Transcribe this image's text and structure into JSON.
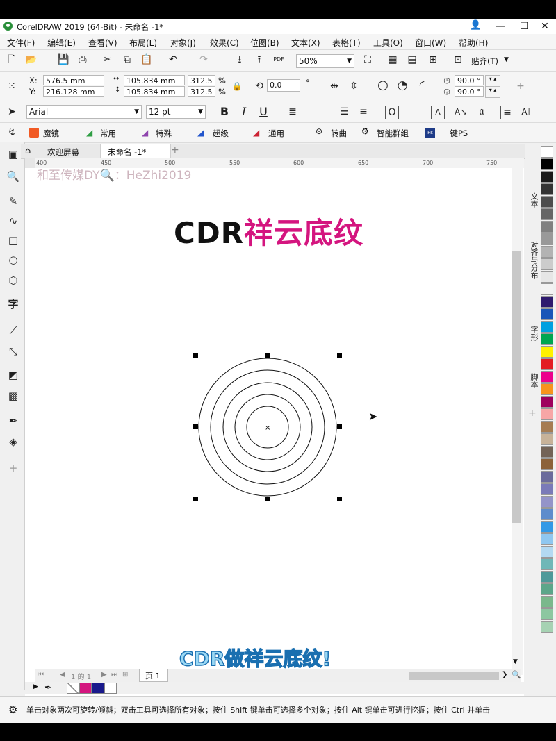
{
  "window": {
    "title": "CorelDRAW 2019 (64-Bit) - 未命名 -1*"
  },
  "menu": [
    "文件(F)",
    "编辑(E)",
    "查看(V)",
    "布局(L)",
    "对象(J)",
    "效果(C)",
    "位图(B)",
    "文本(X)",
    "表格(T)",
    "工具(O)",
    "窗口(W)",
    "帮助(H)"
  ],
  "standard": {
    "zoom": "50%",
    "snap_label": "贴齐(T)"
  },
  "property": {
    "x_label": "X:",
    "x_value": "576.5 mm",
    "y_label": "Y:",
    "y_value": "216.128 mm",
    "w_value": "105.834 mm",
    "h_value": "105.834 mm",
    "sx_value": "312.5",
    "sy_value": "312.5",
    "pct": "%",
    "pct2": "%",
    "rotation": "0.0",
    "deg": "°",
    "arc_start": "90.0 °",
    "arc_end": "90.0 °"
  },
  "text_bar": {
    "font": "Arial",
    "size": "12 pt"
  },
  "plugin_bar": {
    "items": [
      "魔镜",
      "常用",
      "特殊",
      "超级",
      "通用",
      "转曲",
      "智能群组",
      "一键PS"
    ]
  },
  "tabs": {
    "welcome": "欢迎屏幕",
    "doc": "未命名 -1*"
  },
  "ruler": {
    "ticks": [
      "400",
      "450",
      "500",
      "550",
      "600",
      "650",
      "700",
      "750"
    ]
  },
  "canvas": {
    "watermark": "和至传媒DY🔍：HeZhi2019",
    "title_part1": "CDR",
    "title_part2": "祥云底纹",
    "subtitle": "CDR做祥云底纹!"
  },
  "dockers": [
    "文本",
    "对齐与分布",
    "字形",
    "脚本"
  ],
  "pagebar": {
    "page_label": "页 1",
    "counter": "1 的 1"
  },
  "status": {
    "message": "单击对象两次可旋转/倾斜；双击工具可选择所有对象；按住 Shift 键单击可选择多个对象；按住 Alt 键单击可进行挖掘；按住 Ctrl 并单击"
  },
  "palette_colors": [
    "#ffffff",
    "#000000",
    "#1a1a1a",
    "#333333",
    "#4d4d4d",
    "#666666",
    "#808080",
    "#999999",
    "#b3b3b3",
    "#cccccc",
    "#e6e6e6",
    "#f2f2f2",
    "#2e1a6e",
    "#1a56b8",
    "#00a0e0",
    "#00a651",
    "#fff200",
    "#e31e24",
    "#ec008c",
    "#f7941d",
    "#9e005d",
    "#f7a6a6",
    "#a67c52",
    "#c7b299",
    "#736357",
    "#8c6239",
    "#6b6b9c",
    "#7a7ab8",
    "#9494c9",
    "#5e8ccc",
    "#3399e6",
    "#8fc7f0",
    "#b3d9f2",
    "#6fb7b7",
    "#4d9999",
    "#5ca68a",
    "#7ab88c",
    "#8cc7a0",
    "#a6d2b3"
  ],
  "accent": {
    "magenta": "#d4157f",
    "black": "#111111",
    "cyan_text": "#9ad8f4"
  }
}
